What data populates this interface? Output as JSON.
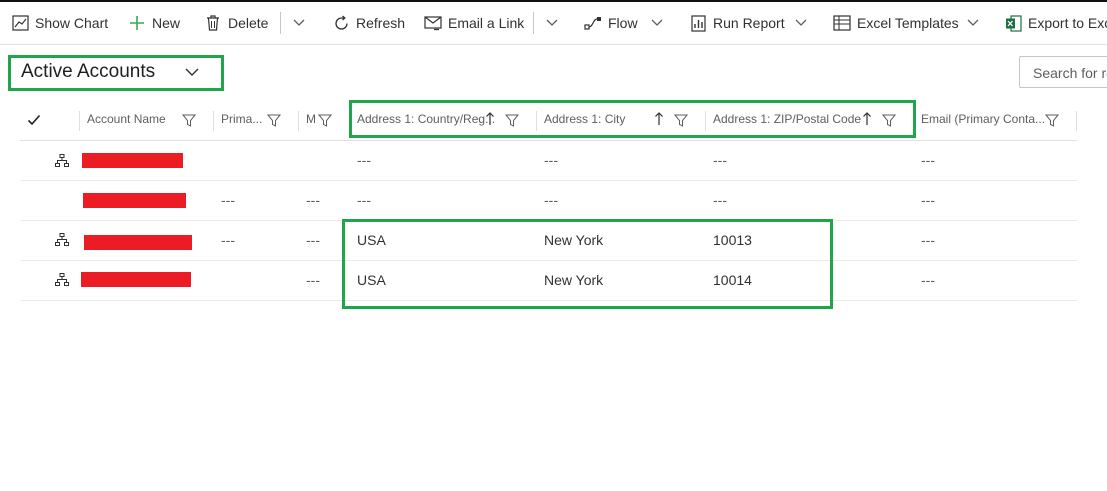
{
  "toolbar": {
    "show_chart": "Show Chart",
    "new": "New",
    "delete": "Delete",
    "refresh": "Refresh",
    "email_link": "Email a Link",
    "flow": "Flow",
    "run_report": "Run Report",
    "excel_templates": "Excel Templates",
    "export": "Export to Exc"
  },
  "view": {
    "title": "Active Accounts"
  },
  "search": {
    "placeholder": "Search for re"
  },
  "grid": {
    "columns": [
      "Account Name",
      "Prima...",
      "M",
      "Address 1: Country/Reg...",
      "Address 1: City",
      "Address 1: ZIP/Postal Code",
      "Email (Primary Conta..."
    ],
    "rows": [
      {
        "c1": "",
        "c2": "",
        "c3": "---",
        "c4": "---",
        "c5": "---",
        "c6": "---"
      },
      {
        "c1": "---",
        "c2": "---",
        "c3": "---",
        "c4": "---",
        "c5": "---",
        "c6": "---"
      },
      {
        "c1": "---",
        "c2": "---",
        "c3": "USA",
        "c4": "New York",
        "c5": "10013",
        "c6": "---"
      },
      {
        "c1": "",
        "c2": "---",
        "c3": "USA",
        "c4": "New York",
        "c5": "10014",
        "c6": "---"
      }
    ]
  },
  "colors": {
    "highlight": "#1fa64a",
    "redaction": "#ec1c24",
    "excel_green": "#1d6f42",
    "accent_green": "#3aa757"
  }
}
